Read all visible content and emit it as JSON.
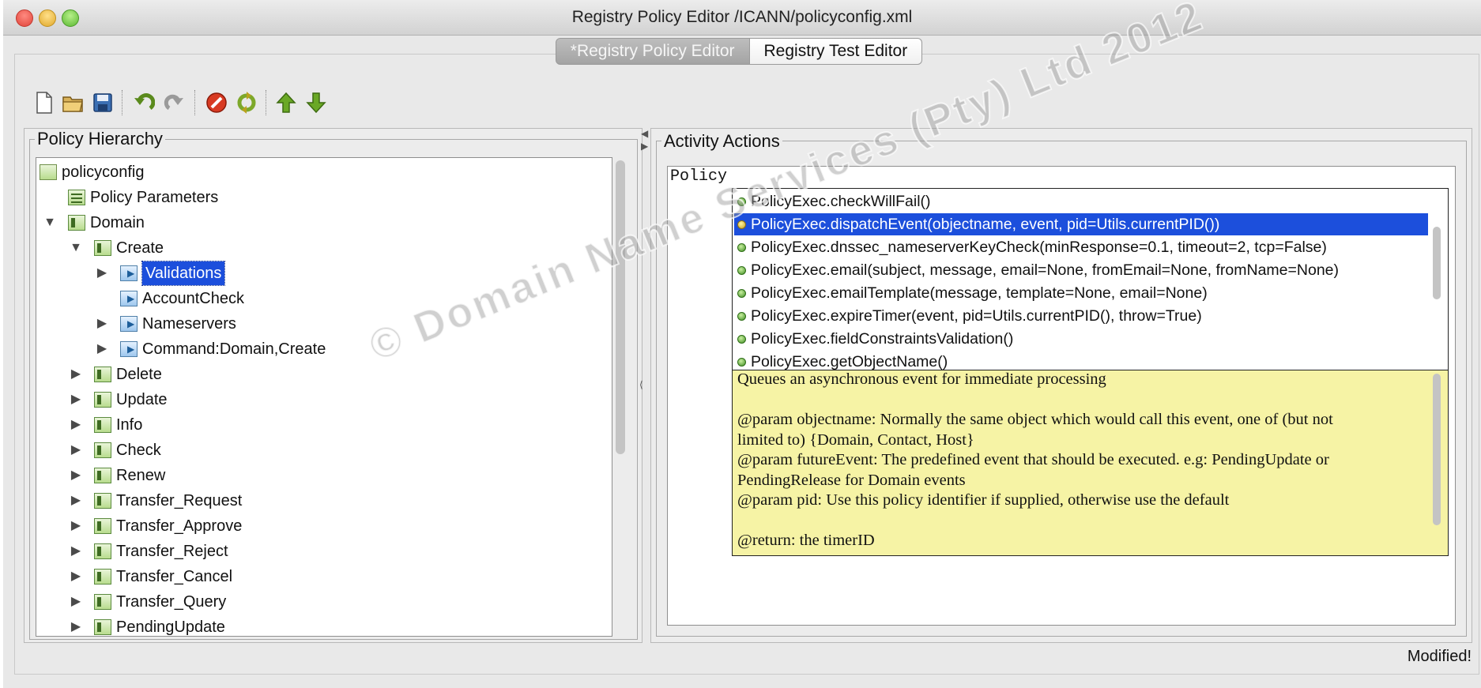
{
  "window": {
    "title": "Registry Policy Editor /ICANN/policyconfig.xml"
  },
  "tabs": [
    {
      "label": "*Registry Policy Editor",
      "state": "inactive"
    },
    {
      "label": "Registry Test Editor",
      "state": "active"
    }
  ],
  "toolbar": {
    "icons": [
      "new-file-icon",
      "open-folder-icon",
      "save-icon",
      "undo-icon",
      "redo-icon",
      "stop-icon",
      "refresh-icon",
      "move-up-icon",
      "move-down-icon"
    ]
  },
  "policy_hierarchy": {
    "title": "Policy Hierarchy",
    "items": [
      {
        "label": "policyconfig",
        "depth": 0,
        "arrow": "",
        "icon": "policy"
      },
      {
        "label": "Policy Parameters",
        "depth": 1,
        "arrow": "",
        "icon": "param"
      },
      {
        "label": "Domain",
        "depth": 1,
        "arrow": "▼",
        "icon": "folder"
      },
      {
        "label": "Create",
        "depth": 2,
        "arrow": "▼",
        "icon": "folder"
      },
      {
        "label": "Validations",
        "depth": 3,
        "arrow": "▶",
        "icon": "exec",
        "selected": true
      },
      {
        "label": "AccountCheck",
        "depth": 3,
        "arrow": "",
        "icon": "exec"
      },
      {
        "label": "Nameservers",
        "depth": 3,
        "arrow": "▶",
        "icon": "exec"
      },
      {
        "label": "Command:Domain,Create",
        "depth": 3,
        "arrow": "▶",
        "icon": "exec"
      },
      {
        "label": "Delete",
        "depth": 2,
        "arrow": "▶",
        "icon": "folder"
      },
      {
        "label": "Update",
        "depth": 2,
        "arrow": "▶",
        "icon": "folder"
      },
      {
        "label": "Info",
        "depth": 2,
        "arrow": "▶",
        "icon": "folder"
      },
      {
        "label": "Check",
        "depth": 2,
        "arrow": "▶",
        "icon": "folder"
      },
      {
        "label": "Renew",
        "depth": 2,
        "arrow": "▶",
        "icon": "folder"
      },
      {
        "label": "Transfer_Request",
        "depth": 2,
        "arrow": "▶",
        "icon": "folder"
      },
      {
        "label": "Transfer_Approve",
        "depth": 2,
        "arrow": "▶",
        "icon": "folder"
      },
      {
        "label": "Transfer_Reject",
        "depth": 2,
        "arrow": "▶",
        "icon": "folder"
      },
      {
        "label": "Transfer_Cancel",
        "depth": 2,
        "arrow": "▶",
        "icon": "folder"
      },
      {
        "label": "Transfer_Query",
        "depth": 2,
        "arrow": "▶",
        "icon": "folder"
      },
      {
        "label": "PendingUpdate",
        "depth": 2,
        "arrow": "▶",
        "icon": "folder"
      }
    ]
  },
  "activity_actions": {
    "title": "Activity Actions",
    "editor_text": "Policy",
    "autocomplete": [
      {
        "label": "PolicyExec.checkWillFail()"
      },
      {
        "label": "PolicyExec.dispatchEvent(objectname, event, pid=Utils.currentPID())",
        "selected": true
      },
      {
        "label": "PolicyExec.dnssec_nameserverKeyCheck(minResponse=0.1, timeout=2, tcp=False)"
      },
      {
        "label": "PolicyExec.email(subject, message, email=None, fromEmail=None, fromName=None)"
      },
      {
        "label": "PolicyExec.emailTemplate(message, template=None, email=None)"
      },
      {
        "label": "PolicyExec.expireTimer(event, pid=Utils.currentPID(), throw=True)"
      },
      {
        "label": "PolicyExec.fieldConstraintsValidation()"
      },
      {
        "label": "PolicyExec.getObjectName()"
      }
    ],
    "documentation": [
      "Queues an asynchronous event for immediate processing",
      "",
      "@param objectname: Normally the same object which would call this event, one of (but not",
      "limited to) {Domain, Contact, Host}",
      "@param futureEvent: The predefined event that should be executed. e.g: PendingUpdate or",
      "PendingRelease for Domain events",
      "@param pid: Use this policy identifier if supplied, otherwise use the default",
      "",
      "@return: the timerID"
    ]
  },
  "status": {
    "text": "Modified!"
  },
  "watermark": {
    "text": "© Domain Name Services (Pty) Ltd 2012"
  },
  "colors": {
    "selection": "#1c4fdc",
    "doc_background": "#f6f3a5"
  }
}
